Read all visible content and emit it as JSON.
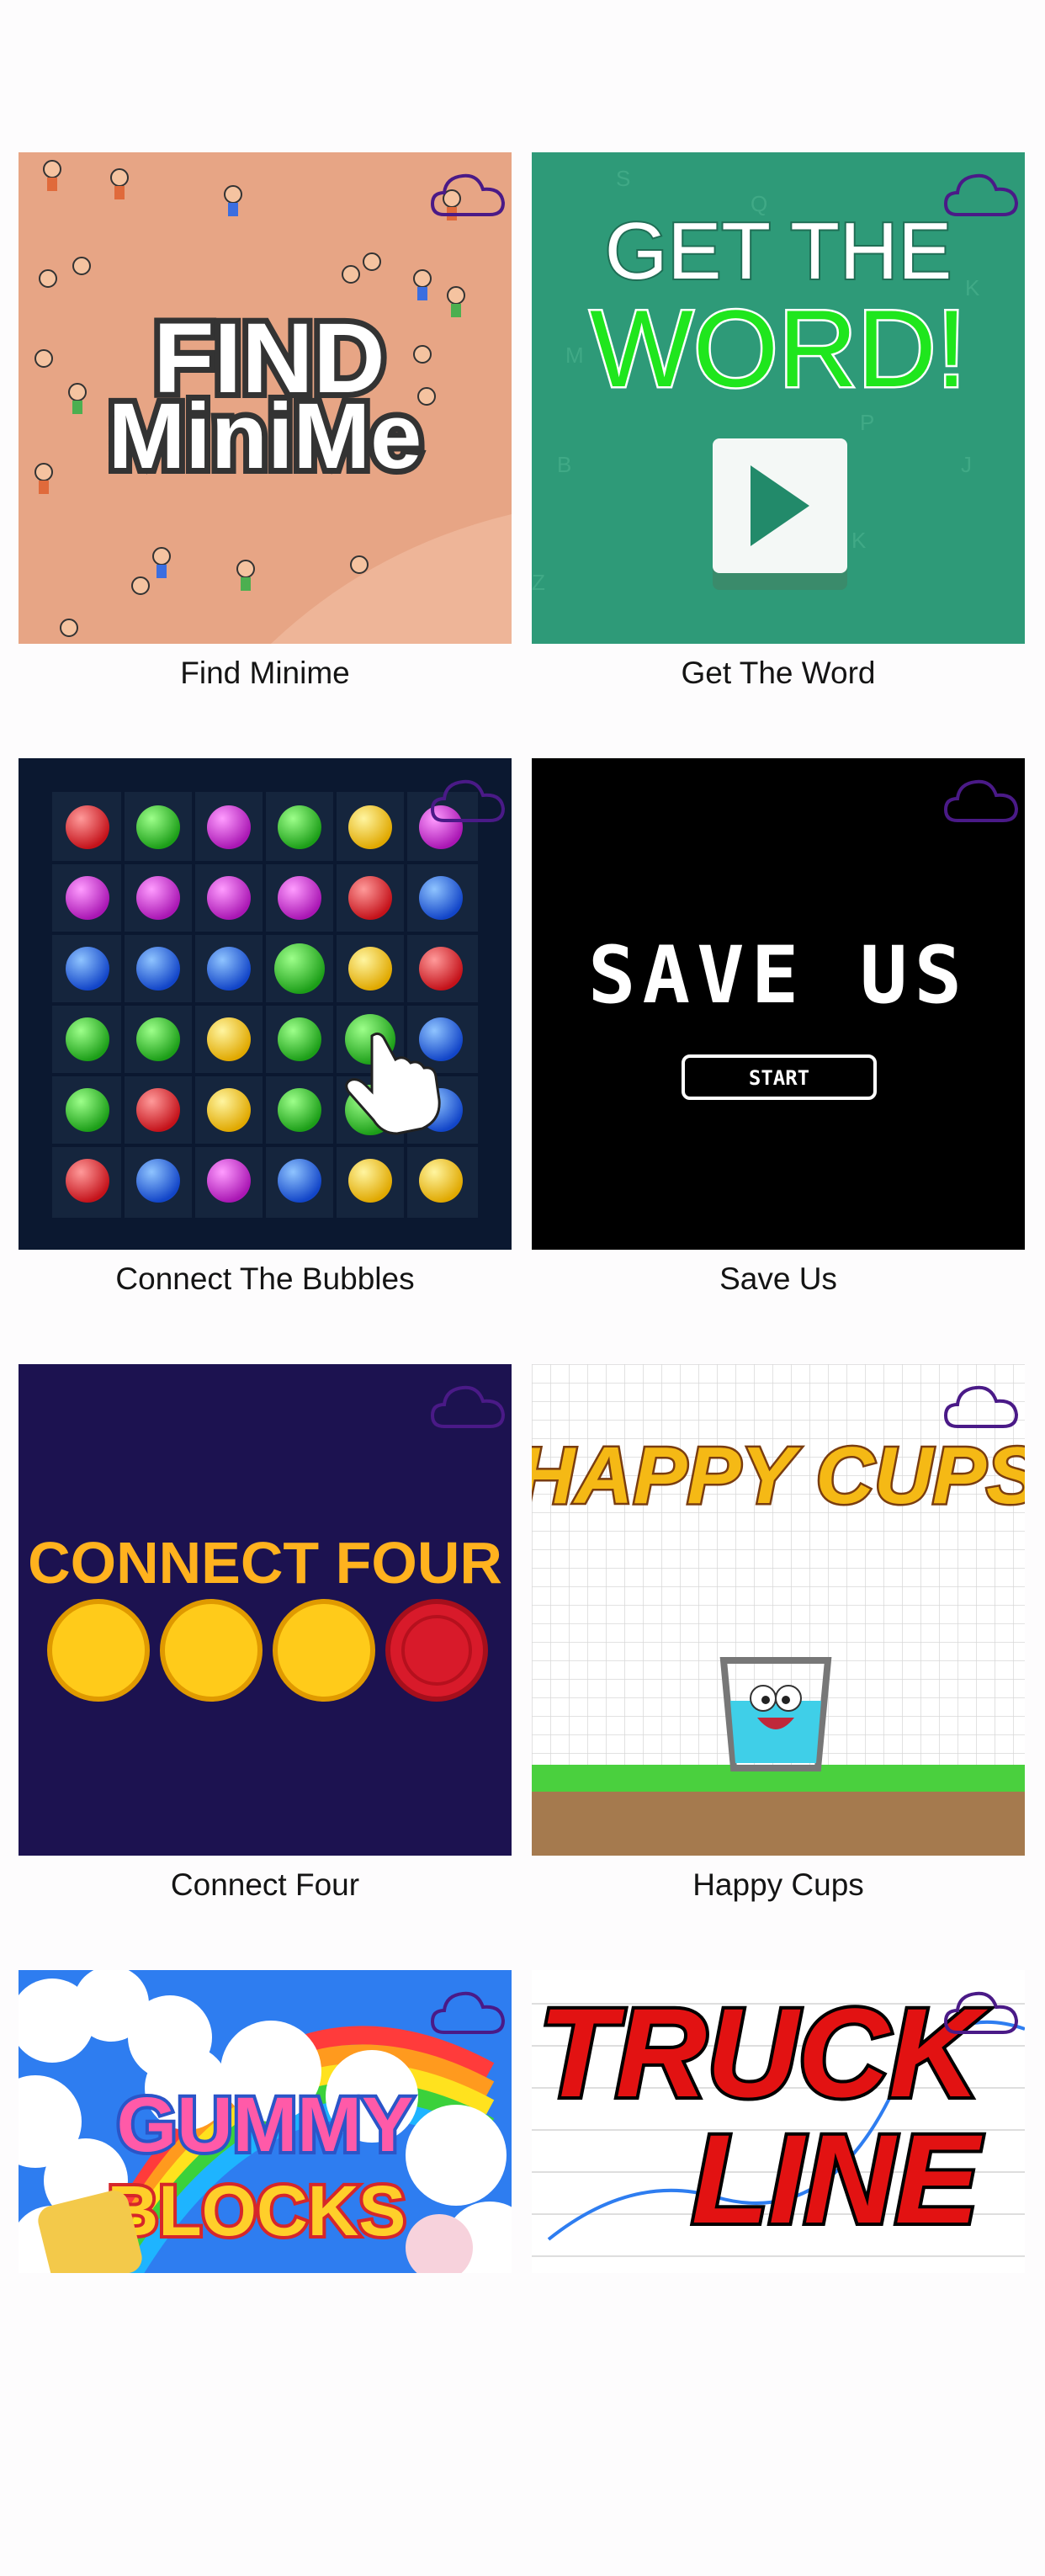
{
  "colors": {
    "cloud": "#4a1a87",
    "background": "#fdfcfd",
    "title_text": "#141414"
  },
  "games": [
    {
      "title": "Find Minime",
      "art_text": [
        "FIND",
        "MiniMe"
      ],
      "cloud_icon": "cloud-icon"
    },
    {
      "title": "Get The Word",
      "art_text": [
        "GET THE",
        "WORD!"
      ],
      "cloud_icon": "cloud-icon"
    },
    {
      "title": "Connect The Bubbles",
      "art_text": [],
      "cloud_icon": "cloud-icon"
    },
    {
      "title": "Save Us",
      "art_text": [
        "SAVE US",
        "START"
      ],
      "cloud_icon": "cloud-icon"
    },
    {
      "title": "Connect Four",
      "art_text": [
        "CONNECT FOUR"
      ],
      "cloud_icon": "cloud-icon"
    },
    {
      "title": "Happy Cups",
      "art_text": [
        "HAPPY CUPS"
      ],
      "cloud_icon": "cloud-icon"
    },
    {
      "title": "",
      "art_text": [
        "GUMMY",
        "BLOCKS"
      ],
      "cloud_icon": "cloud-icon"
    },
    {
      "title": "",
      "art_text": [
        "TRUCK",
        "LINE"
      ],
      "cloud_icon": "cloud-icon"
    }
  ]
}
